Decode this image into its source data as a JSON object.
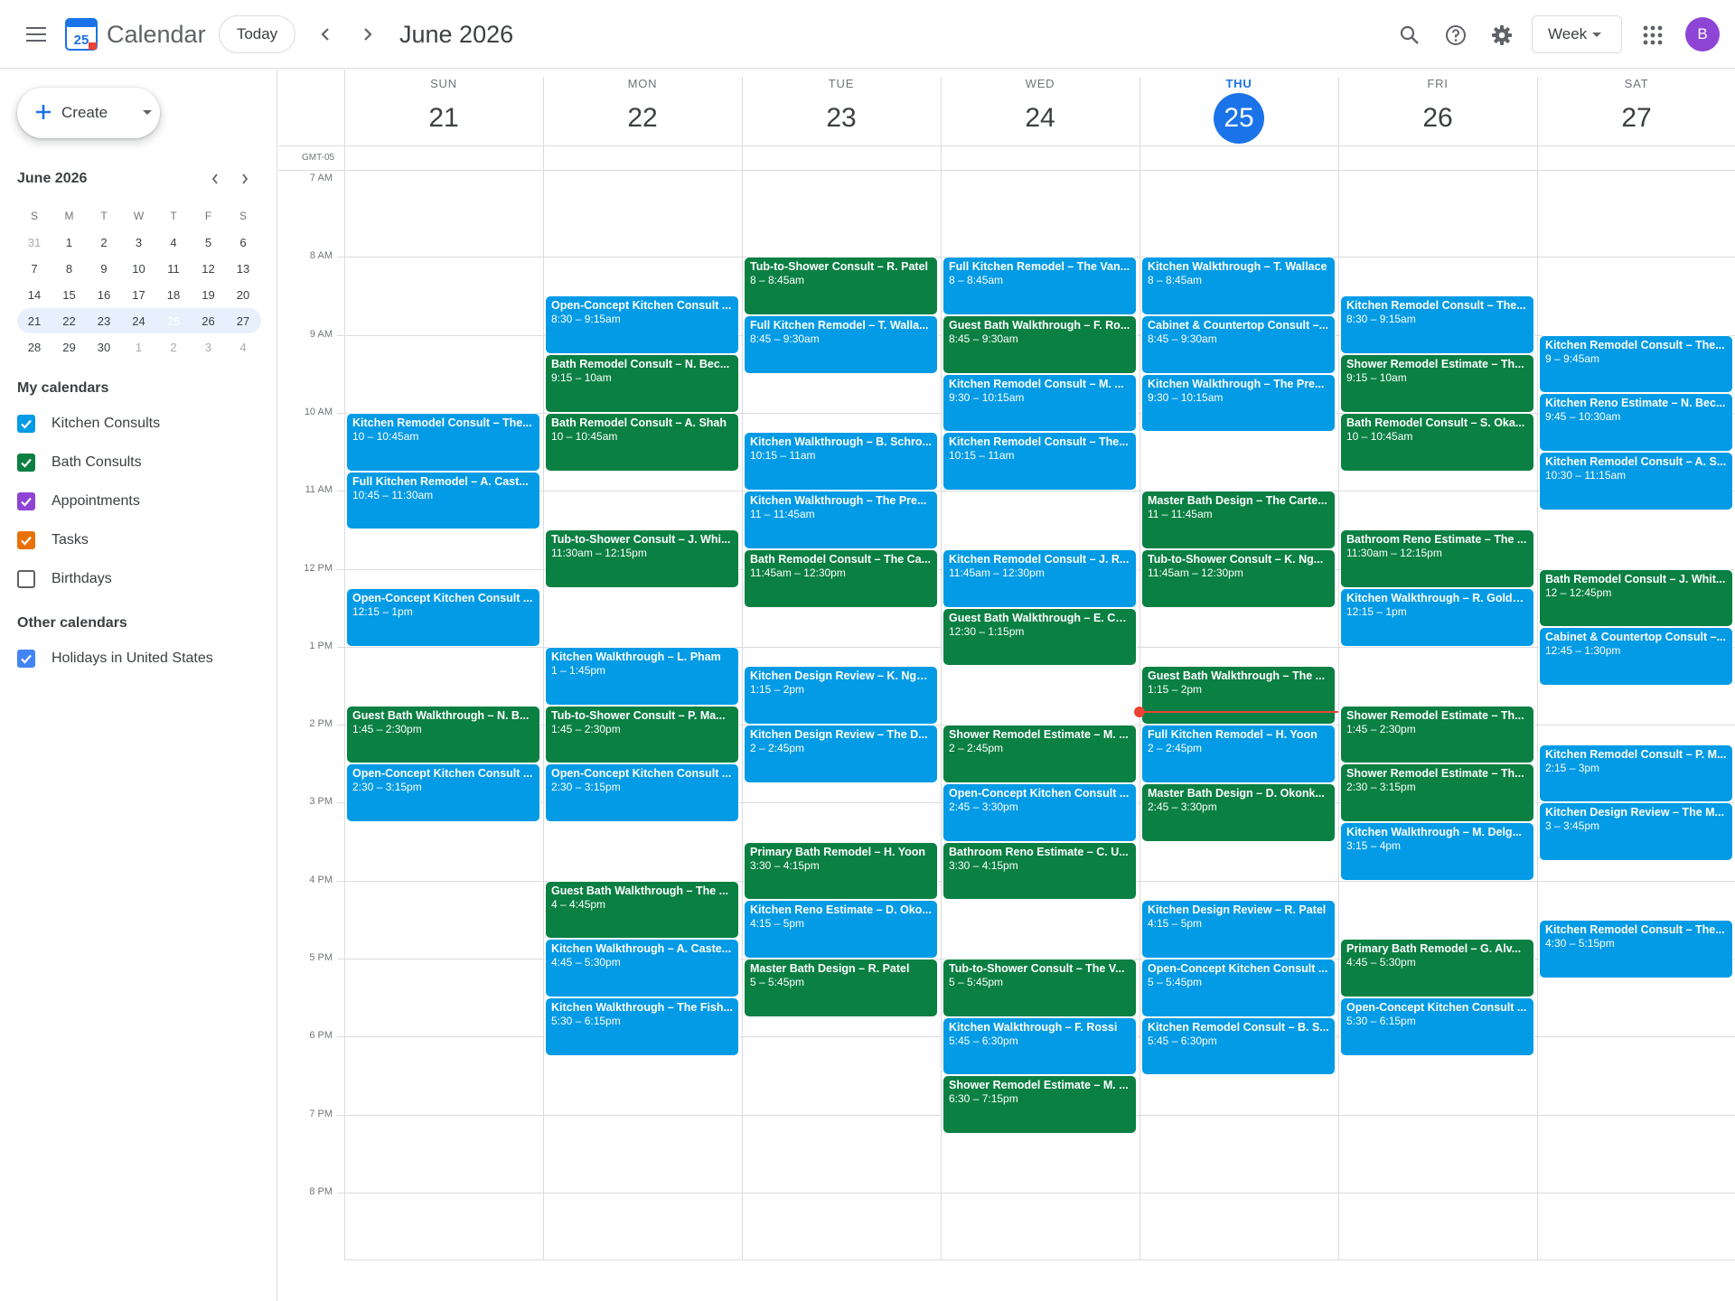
{
  "header": {
    "app_title": "Calendar",
    "logo_day": "25",
    "today_label": "Today",
    "date_title": "June 2026",
    "view_label": "Week",
    "avatar_initial": "B"
  },
  "sidebar": {
    "create_label": "Create",
    "mini_title": "June 2026",
    "dow": [
      "S",
      "M",
      "T",
      "W",
      "T",
      "F",
      "S"
    ],
    "weeks": [
      [
        "31",
        "1",
        "2",
        "3",
        "4",
        "5",
        "6"
      ],
      [
        "7",
        "8",
        "9",
        "10",
        "11",
        "12",
        "13"
      ],
      [
        "14",
        "15",
        "16",
        "17",
        "18",
        "19",
        "20"
      ],
      [
        "21",
        "22",
        "23",
        "24",
        "25",
        "26",
        "27"
      ],
      [
        "28",
        "29",
        "30",
        "1",
        "2",
        "3",
        "4"
      ]
    ],
    "my_calendars_title": "My calendars",
    "my_calendars": [
      {
        "label": "Kitchen Consults",
        "color": "#039be5",
        "checked": true
      },
      {
        "label": "Bath Consults",
        "color": "#0b8043",
        "checked": true
      },
      {
        "label": "Appointments",
        "color": "#8e44d4",
        "checked": true
      },
      {
        "label": "Tasks",
        "color": "#e8710a",
        "checked": true
      },
      {
        "label": "Birthdays",
        "color": "#616161",
        "checked": false
      }
    ],
    "other_calendars_title": "Other calendars",
    "other_calendars": [
      {
        "label": "Holidays in United States",
        "color": "#4285f4",
        "checked": true
      }
    ]
  },
  "week": {
    "timezone": "GMT-05",
    "days": [
      {
        "dow": "SUN",
        "num": "21"
      },
      {
        "dow": "MON",
        "num": "22"
      },
      {
        "dow": "TUE",
        "num": "23"
      },
      {
        "dow": "WED",
        "num": "24"
      },
      {
        "dow": "THU",
        "num": "25",
        "today": true
      },
      {
        "dow": "FRI",
        "num": "26"
      },
      {
        "dow": "SAT",
        "num": "27"
      }
    ],
    "hours": [
      "7 AM",
      "8 AM",
      "9 AM",
      "10 AM",
      "11 AM",
      "12 PM",
      "1 PM",
      "2 PM",
      "3 PM",
      "4 PM",
      "5 PM",
      "6 PM",
      "7 PM",
      "8 PM"
    ],
    "now_time": "13:50"
  },
  "colors": {
    "kitchen": "#039be5",
    "bath": "#0b8043",
    "accent": "#1a73e8",
    "now": "#ea4335"
  },
  "events": [
    {
      "day": 0,
      "start": "10:00",
      "end": "10:45",
      "cal": "kitchen",
      "title": "Kitchen Remodel Consult – The...",
      "time": "10 – 10:45am"
    },
    {
      "day": 0,
      "start": "10:45",
      "end": "11:30",
      "cal": "kitchen",
      "title": "Full Kitchen Remodel – A. Cast...",
      "time": "10:45 – 11:30am"
    },
    {
      "day": 0,
      "start": "12:15",
      "end": "13:00",
      "cal": "kitchen",
      "title": "Open-Concept Kitchen Consult ...",
      "time": "12:15 – 1pm"
    },
    {
      "day": 0,
      "start": "13:45",
      "end": "14:30",
      "cal": "bath",
      "title": "Guest Bath Walkthrough – N. B...",
      "time": "1:45 – 2:30pm"
    },
    {
      "day": 0,
      "start": "14:30",
      "end": "15:15",
      "cal": "kitchen",
      "title": "Open-Concept Kitchen Consult ...",
      "time": "2:30 – 3:15pm"
    },
    {
      "day": 1,
      "start": "08:30",
      "end": "09:15",
      "cal": "kitchen",
      "title": "Open-Concept Kitchen Consult ...",
      "time": "8:30 – 9:15am"
    },
    {
      "day": 1,
      "start": "09:15",
      "end": "10:00",
      "cal": "bath",
      "title": "Bath Remodel Consult – N. Bec...",
      "time": "9:15 – 10am"
    },
    {
      "day": 1,
      "start": "10:00",
      "end": "10:45",
      "cal": "bath",
      "title": "Bath Remodel Consult – A. Shah",
      "time": "10 – 10:45am"
    },
    {
      "day": 1,
      "start": "11:30",
      "end": "12:15",
      "cal": "bath",
      "title": "Tub-to-Shower Consult – J. Whi...",
      "time": "11:30am – 12:15pm"
    },
    {
      "day": 1,
      "start": "13:00",
      "end": "13:45",
      "cal": "kitchen",
      "title": "Kitchen Walkthrough – L. Pham",
      "time": "1 – 1:45pm"
    },
    {
      "day": 1,
      "start": "13:45",
      "end": "14:30",
      "cal": "bath",
      "title": "Tub-to-Shower Consult – P. Ma...",
      "time": "1:45 – 2:30pm"
    },
    {
      "day": 1,
      "start": "14:30",
      "end": "15:15",
      "cal": "kitchen",
      "title": "Open-Concept Kitchen Consult ...",
      "time": "2:30 – 3:15pm"
    },
    {
      "day": 1,
      "start": "16:00",
      "end": "16:45",
      "cal": "bath",
      "title": "Guest Bath Walkthrough – The ...",
      "time": "4 – 4:45pm"
    },
    {
      "day": 1,
      "start": "16:45",
      "end": "17:30",
      "cal": "kitchen",
      "title": "Kitchen Walkthrough – A. Caste...",
      "time": "4:45 – 5:30pm"
    },
    {
      "day": 1,
      "start": "17:30",
      "end": "18:15",
      "cal": "kitchen",
      "title": "Kitchen Walkthrough – The Fish...",
      "time": "5:30 – 6:15pm"
    },
    {
      "day": 2,
      "start": "08:00",
      "end": "08:45",
      "cal": "bath",
      "title": "Tub-to-Shower Consult – R. Patel",
      "time": "8 – 8:45am"
    },
    {
      "day": 2,
      "start": "08:45",
      "end": "09:30",
      "cal": "kitchen",
      "title": "Full Kitchen Remodel – T. Walla...",
      "time": "8:45 – 9:30am"
    },
    {
      "day": 2,
      "start": "10:15",
      "end": "11:00",
      "cal": "kitchen",
      "title": "Kitchen Walkthrough – B. Schro...",
      "time": "10:15 – 11am"
    },
    {
      "day": 2,
      "start": "11:00",
      "end": "11:45",
      "cal": "kitchen",
      "title": "Kitchen Walkthrough – The Pre...",
      "time": "11 – 11:45am"
    },
    {
      "day": 2,
      "start": "11:45",
      "end": "12:30",
      "cal": "bath",
      "title": "Bath Remodel Consult – The Ca...",
      "time": "11:45am – 12:30pm"
    },
    {
      "day": 2,
      "start": "13:15",
      "end": "14:00",
      "cal": "kitchen",
      "title": "Kitchen Design Review – K. Ngu...",
      "time": "1:15 – 2pm"
    },
    {
      "day": 2,
      "start": "14:00",
      "end": "14:45",
      "cal": "kitchen",
      "title": "Kitchen Design Review – The D...",
      "time": "2 – 2:45pm"
    },
    {
      "day": 2,
      "start": "15:30",
      "end": "16:15",
      "cal": "bath",
      "title": "Primary Bath Remodel – H. Yoon",
      "time": "3:30 – 4:15pm"
    },
    {
      "day": 2,
      "start": "16:15",
      "end": "17:00",
      "cal": "kitchen",
      "title": "Kitchen Reno Estimate – D. Oko...",
      "time": "4:15 – 5pm"
    },
    {
      "day": 2,
      "start": "17:00",
      "end": "17:45",
      "cal": "bath",
      "title": "Master Bath Design – R. Patel",
      "time": "5 – 5:45pm"
    },
    {
      "day": 3,
      "start": "08:00",
      "end": "08:45",
      "cal": "kitchen",
      "title": "Full Kitchen Remodel – The Van...",
      "time": "8 – 8:45am"
    },
    {
      "day": 3,
      "start": "08:45",
      "end": "09:30",
      "cal": "bath",
      "title": "Guest Bath Walkthrough – F. Ro...",
      "time": "8:45 – 9:30am"
    },
    {
      "day": 3,
      "start": "09:30",
      "end": "10:15",
      "cal": "kitchen",
      "title": "Kitchen Remodel Consult – M. ...",
      "time": "9:30 – 10:15am"
    },
    {
      "day": 3,
      "start": "10:15",
      "end": "11:00",
      "cal": "kitchen",
      "title": "Kitchen Remodel Consult – The...",
      "time": "10:15 – 11am"
    },
    {
      "day": 3,
      "start": "11:45",
      "end": "12:30",
      "cal": "kitchen",
      "title": "Kitchen Remodel Consult – J. R...",
      "time": "11:45am – 12:30pm"
    },
    {
      "day": 3,
      "start": "12:30",
      "end": "13:15",
      "cal": "bath",
      "title": "Guest Bath Walkthrough – E. Ca...",
      "time": "12:30 – 1:15pm"
    },
    {
      "day": 3,
      "start": "14:00",
      "end": "14:45",
      "cal": "bath",
      "title": "Shower Remodel Estimate – M. ...",
      "time": "2 – 2:45pm"
    },
    {
      "day": 3,
      "start": "14:45",
      "end": "15:30",
      "cal": "kitchen",
      "title": "Open-Concept Kitchen Consult ...",
      "time": "2:45 – 3:30pm"
    },
    {
      "day": 3,
      "start": "15:30",
      "end": "16:15",
      "cal": "bath",
      "title": "Bathroom Reno Estimate – C. U...",
      "time": "3:30 – 4:15pm"
    },
    {
      "day": 3,
      "start": "17:00",
      "end": "17:45",
      "cal": "bath",
      "title": "Tub-to-Shower Consult – The V...",
      "time": "5 – 5:45pm"
    },
    {
      "day": 3,
      "start": "17:45",
      "end": "18:30",
      "cal": "kitchen",
      "title": "Kitchen Walkthrough – F. Rossi",
      "time": "5:45 – 6:30pm"
    },
    {
      "day": 3,
      "start": "18:30",
      "end": "19:15",
      "cal": "bath",
      "title": "Shower Remodel Estimate – M. ...",
      "time": "6:30 – 7:15pm"
    },
    {
      "day": 4,
      "start": "08:00",
      "end": "08:45",
      "cal": "kitchen",
      "title": "Kitchen Walkthrough – T. Wallace",
      "time": "8 – 8:45am"
    },
    {
      "day": 4,
      "start": "08:45",
      "end": "09:30",
      "cal": "kitchen",
      "title": "Cabinet & Countertop Consult –...",
      "time": "8:45 – 9:30am"
    },
    {
      "day": 4,
      "start": "09:30",
      "end": "10:15",
      "cal": "kitchen",
      "title": "Kitchen Walkthrough – The Pre...",
      "time": "9:30 – 10:15am"
    },
    {
      "day": 4,
      "start": "11:00",
      "end": "11:45",
      "cal": "bath",
      "title": "Master Bath Design – The Carte...",
      "time": "11 – 11:45am"
    },
    {
      "day": 4,
      "start": "11:45",
      "end": "12:30",
      "cal": "bath",
      "title": "Tub-to-Shower Consult – K. Ng...",
      "time": "11:45am – 12:30pm"
    },
    {
      "day": 4,
      "start": "13:15",
      "end": "14:00",
      "cal": "bath",
      "title": "Guest Bath Walkthrough – The ...",
      "time": "1:15 – 2pm"
    },
    {
      "day": 4,
      "start": "14:00",
      "end": "14:45",
      "cal": "kitchen",
      "title": "Full Kitchen Remodel – H. Yoon",
      "time": "2 – 2:45pm"
    },
    {
      "day": 4,
      "start": "14:45",
      "end": "15:30",
      "cal": "bath",
      "title": "Master Bath Design – D. Okonk...",
      "time": "2:45 – 3:30pm"
    },
    {
      "day": 4,
      "start": "16:15",
      "end": "17:00",
      "cal": "kitchen",
      "title": "Kitchen Design Review – R. Patel",
      "time": "4:15 – 5pm"
    },
    {
      "day": 4,
      "start": "17:00",
      "end": "17:45",
      "cal": "kitchen",
      "title": "Open-Concept Kitchen Consult ...",
      "time": "5 – 5:45pm"
    },
    {
      "day": 4,
      "start": "17:45",
      "end": "18:30",
      "cal": "kitchen",
      "title": "Kitchen Remodel Consult – B. S...",
      "time": "5:45 – 6:30pm"
    },
    {
      "day": 5,
      "start": "08:30",
      "end": "09:15",
      "cal": "kitchen",
      "title": "Kitchen Remodel Consult – The...",
      "time": "8:30 – 9:15am"
    },
    {
      "day": 5,
      "start": "09:15",
      "end": "10:00",
      "cal": "bath",
      "title": "Shower Remodel Estimate – Th...",
      "time": "9:15 – 10am"
    },
    {
      "day": 5,
      "start": "10:00",
      "end": "10:45",
      "cal": "bath",
      "title": "Bath Remodel Consult – S. Oka...",
      "time": "10 – 10:45am"
    },
    {
      "day": 5,
      "start": "11:30",
      "end": "12:15",
      "cal": "bath",
      "title": "Bathroom Reno Estimate – The ...",
      "time": "11:30am – 12:15pm"
    },
    {
      "day": 5,
      "start": "12:15",
      "end": "13:00",
      "cal": "kitchen",
      "title": "Kitchen Walkthrough – R. Goldb...",
      "time": "12:15 – 1pm"
    },
    {
      "day": 5,
      "start": "13:45",
      "end": "14:30",
      "cal": "bath",
      "title": "Shower Remodel Estimate – Th...",
      "time": "1:45 – 2:30pm"
    },
    {
      "day": 5,
      "start": "14:30",
      "end": "15:15",
      "cal": "bath",
      "title": "Shower Remodel Estimate – Th...",
      "time": "2:30 – 3:15pm"
    },
    {
      "day": 5,
      "start": "15:15",
      "end": "16:00",
      "cal": "kitchen",
      "title": "Kitchen Walkthrough – M. Delg...",
      "time": "3:15 – 4pm"
    },
    {
      "day": 5,
      "start": "16:45",
      "end": "17:30",
      "cal": "bath",
      "title": "Primary Bath Remodel – G. Alv...",
      "time": "4:45 – 5:30pm"
    },
    {
      "day": 5,
      "start": "17:30",
      "end": "18:15",
      "cal": "kitchen",
      "title": "Open-Concept Kitchen Consult ...",
      "time": "5:30 – 6:15pm"
    },
    {
      "day": 6,
      "start": "09:00",
      "end": "09:45",
      "cal": "kitchen",
      "title": "Kitchen Remodel Consult – The...",
      "time": "9 – 9:45am"
    },
    {
      "day": 6,
      "start": "09:45",
      "end": "10:30",
      "cal": "kitchen",
      "title": "Kitchen Reno Estimate – N. Bec...",
      "time": "9:45 – 10:30am"
    },
    {
      "day": 6,
      "start": "10:30",
      "end": "11:15",
      "cal": "kitchen",
      "title": "Kitchen Remodel Consult – A. S...",
      "time": "10:30 – 11:15am"
    },
    {
      "day": 6,
      "start": "12:00",
      "end": "12:45",
      "cal": "bath",
      "title": "Bath Remodel Consult – J. Whit...",
      "time": "12 – 12:45pm"
    },
    {
      "day": 6,
      "start": "12:45",
      "end": "13:30",
      "cal": "kitchen",
      "title": "Cabinet & Countertop Consult –...",
      "time": "12:45 – 1:30pm"
    },
    {
      "day": 6,
      "start": "14:15",
      "end": "15:00",
      "cal": "kitchen",
      "title": "Kitchen Remodel Consult – P. M...",
      "time": "2:15 – 3pm"
    },
    {
      "day": 6,
      "start": "15:00",
      "end": "15:45",
      "cal": "kitchen",
      "title": "Kitchen Design Review – The M...",
      "time": "3 – 3:45pm"
    },
    {
      "day": 6,
      "start": "16:30",
      "end": "17:15",
      "cal": "kitchen",
      "title": "Kitchen Remodel Consult – The...",
      "time": "4:30 – 5:15pm"
    }
  ]
}
